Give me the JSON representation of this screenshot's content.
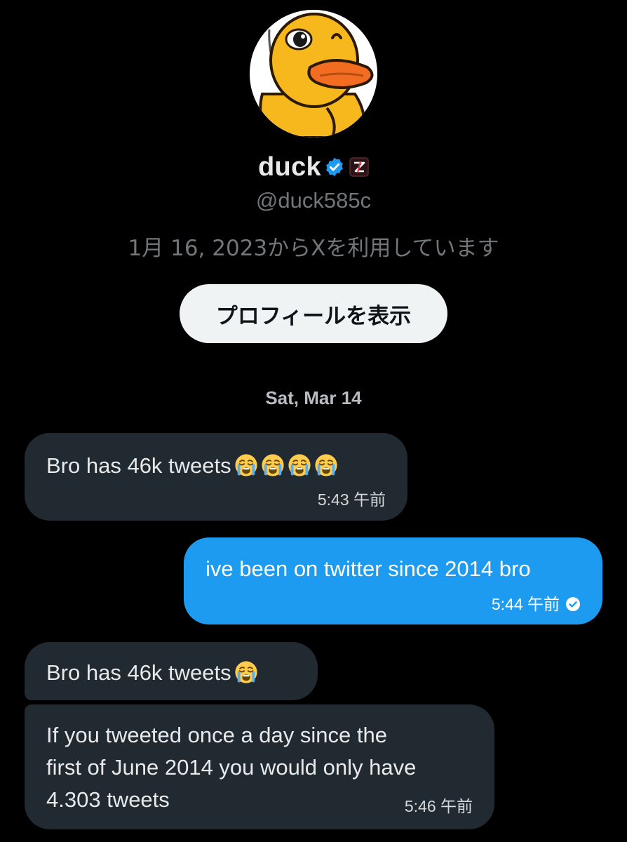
{
  "profile": {
    "display_name": "duck",
    "handle": "@duck585c",
    "joined": "1月 16, 2023からXを利用しています",
    "view_profile_label": "プロフィールを表示",
    "verified_icon": "verified-badge-icon",
    "affiliate_icon": "affiliate-badge-icon",
    "avatar": "duck-avatar"
  },
  "conversation": {
    "date_separator": "Sat, Mar 14",
    "messages": [
      {
        "direction": "received",
        "text": "Bro has 46k tweets",
        "emojis": [
          "loudly-crying-face",
          "loudly-crying-face",
          "loudly-crying-face",
          "loudly-crying-face"
        ],
        "time": "5:43 午前"
      },
      {
        "direction": "sent",
        "text": "ive been on twitter since 2014 bro",
        "time": "5:44 午前",
        "status_icon": "read-check-icon"
      },
      {
        "direction": "received",
        "text": "Bro has 46k tweets",
        "emojis": [
          "loudly-crying-face"
        ]
      },
      {
        "direction": "received",
        "lines": [
          "If you tweeted once a day since the",
          "first of June 2014 you would only have",
          "4.303 tweets"
        ],
        "time": "5:46 午前"
      }
    ]
  },
  "colors": {
    "background": "#000000",
    "received_bubble": "#222a31",
    "sent_bubble": "#1d9bf0",
    "muted_text": "#71767b",
    "button_bg": "#eff3f4"
  }
}
